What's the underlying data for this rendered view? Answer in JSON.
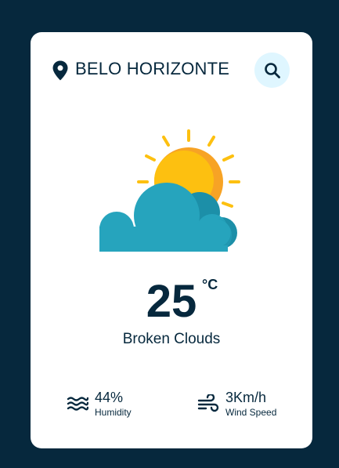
{
  "location": {
    "icon": "map-pin-icon",
    "city": "BELO HORIZONTE"
  },
  "search": {
    "icon": "search-icon"
  },
  "weather": {
    "icon": "sun-behind-cloud-icon",
    "temperature": "25",
    "unit": "°C",
    "description": "Broken Clouds"
  },
  "details": {
    "humidity": {
      "icon": "water-waves-icon",
      "value": "44%",
      "label": "Humidity"
    },
    "wind": {
      "icon": "wind-icon",
      "value": "3Km/h",
      "label": "Wind Speed"
    }
  },
  "colors": {
    "background": "#06283D",
    "card": "#FFFFFF",
    "search_button": "#DFF6FF",
    "text": "#06283D",
    "sun": "#FDC010",
    "sun_shade": "#F7A325",
    "cloud": "#26A4BD",
    "cloud_shade": "#1C8FA8"
  }
}
